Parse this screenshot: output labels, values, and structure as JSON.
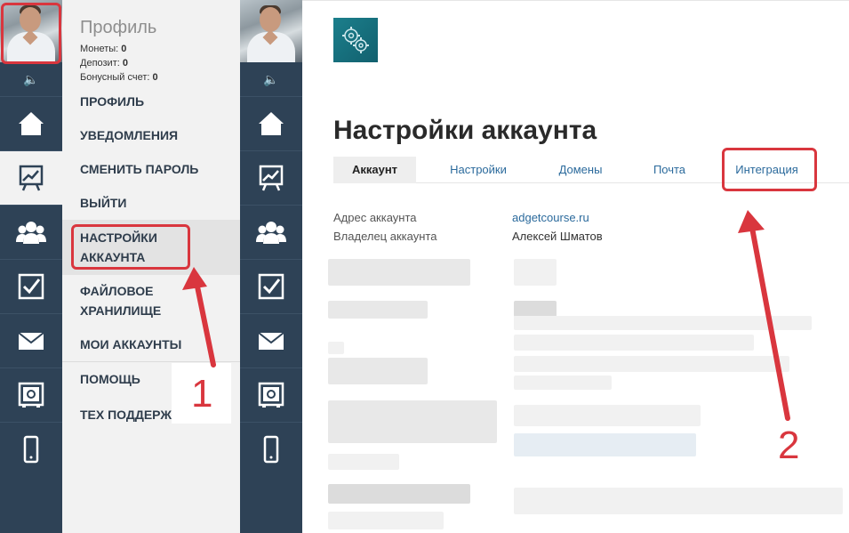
{
  "profile": {
    "title": "Профиль",
    "coins_label": "Монеты:",
    "coins_value": "0",
    "deposit_label": "Депозит:",
    "deposit_value": "0",
    "bonus_label": "Бонусный счет:",
    "bonus_value": "0"
  },
  "menu": {
    "items": [
      "ПРОФИЛЬ",
      "УВЕДОМЛЕНИЯ",
      "СМЕНИТЬ ПАРОЛЬ",
      "ВЫЙТИ",
      "НАСТРОЙКИ АККАУНТА",
      "ФАЙЛОВОЕ ХРАНИЛИЩЕ",
      "МОИ АККАУНТЫ",
      "ПОМОЩЬ",
      "ТЕХ ПОДДЕРЖКА"
    ]
  },
  "rail_icons": [
    "speaker-icon",
    "home-icon",
    "chart-icon",
    "users-icon",
    "checkbox-icon",
    "mail-icon",
    "safe-icon",
    "phone-icon"
  ],
  "annotations": {
    "step1": "1",
    "step2": "2"
  },
  "account": {
    "page_title": "Настройки аккаунта",
    "tabs": [
      "Аккаунт",
      "Настройки",
      "Домены",
      "Почта",
      "Интеграция"
    ],
    "address_label": "Адрес аккаунта",
    "address_value": "adgetcourse.ru",
    "owner_label": "Владелец аккаунта",
    "owner_value": "Алексей Шматов"
  },
  "colors": {
    "rail": "#2e4256",
    "menu_bg": "#f2f2f2",
    "highlight": "#d9363e",
    "link": "#2b6a9c",
    "logo": "#1b7f8c"
  }
}
